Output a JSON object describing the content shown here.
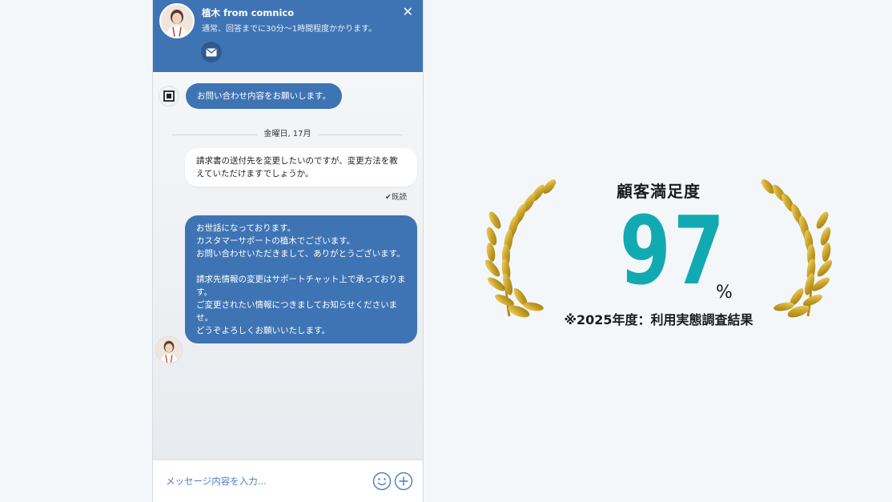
{
  "chat": {
    "agent_name": "植木 from comnico",
    "status_text": "通常、回答までに30分〜1時間程度かかります。",
    "close_icon": "close-icon",
    "mail_icon": "mail-icon",
    "bot_message": "お問い合わせ内容をお願いします。",
    "date_label": "金曜日, 17月",
    "user_message": "請求書の送付先を変更したいのですが、変更方法を教えていただけますでしょうか。",
    "read_status": "✔既読",
    "agent_message": "お世話になっております。\nカスタマーサポートの植木でございます。\nお問い合わせいただきまして、ありがとうございます。\n\n請求先情報の変更はサポートチャット上で承っております。\nご変更されたい情報につきましてお知らせくださいませ。\nどうぞよろしくお願いいたします。",
    "input_placeholder": "メッセージ内容を入力...",
    "accent_color": "#3f74b4"
  },
  "award": {
    "title": "顧客満足度",
    "value": "97",
    "unit": "%",
    "note": "※2025年度：利用実態調査結果",
    "value_color": "#12aab2",
    "wreath_color": "#c9a227"
  }
}
